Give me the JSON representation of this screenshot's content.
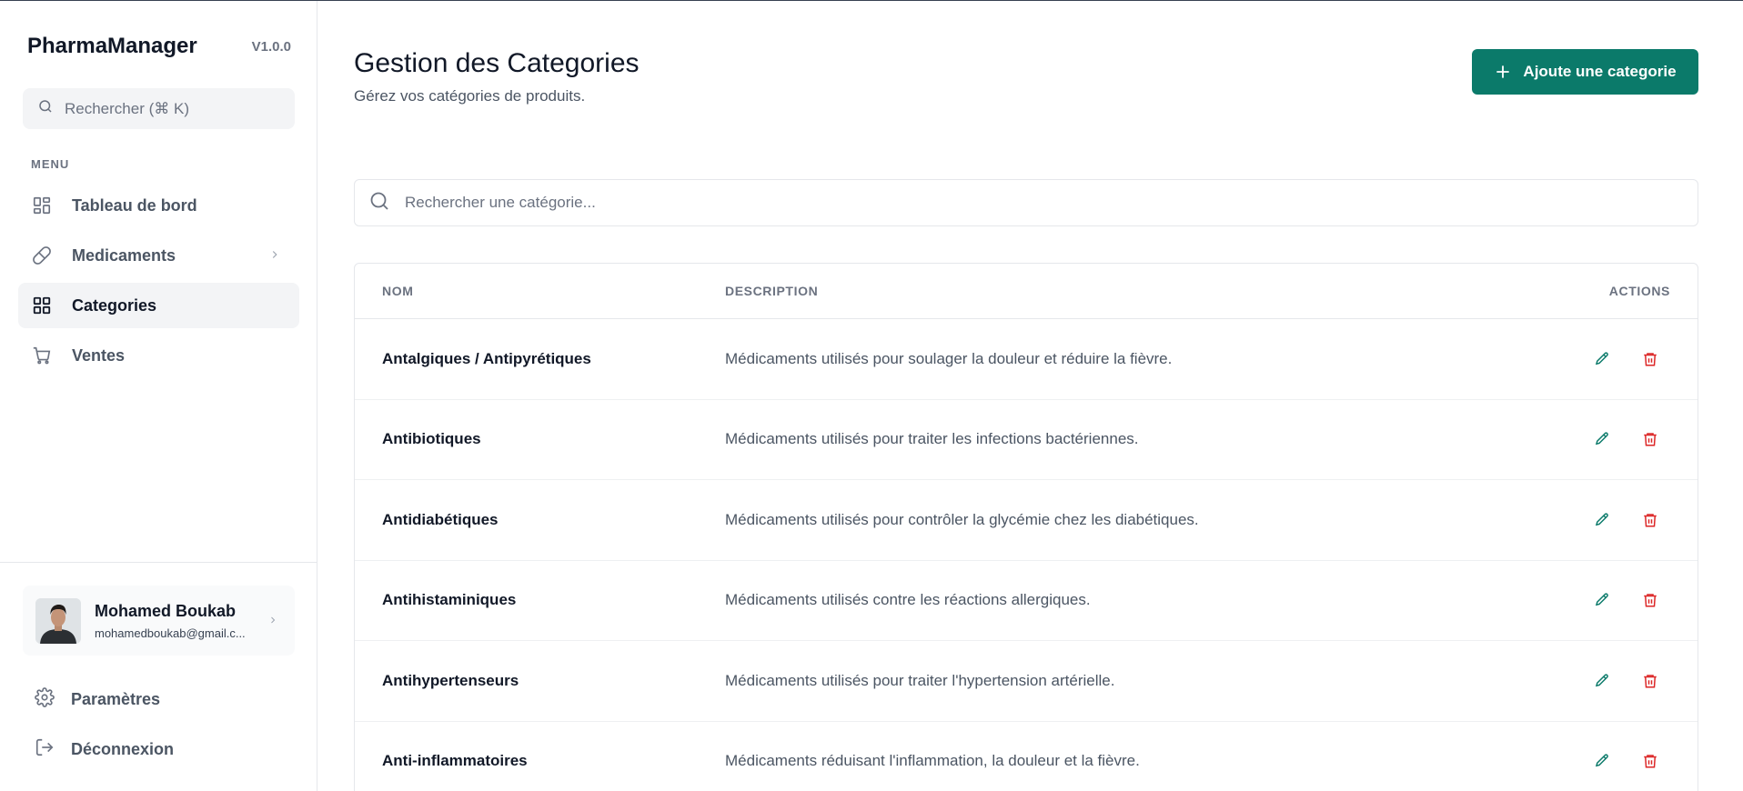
{
  "sidebar": {
    "brand": "PharmaManager",
    "version": "V1.0.0",
    "search_placeholder": "Rechercher (⌘ K)",
    "menu_label": "MENU",
    "items": [
      {
        "label": "Tableau de bord",
        "icon": "dashboard-icon"
      },
      {
        "label": "Medicaments",
        "icon": "pill-icon"
      },
      {
        "label": "Categories",
        "icon": "grid-icon"
      },
      {
        "label": "Ventes",
        "icon": "cart-icon"
      }
    ],
    "user": {
      "name": "Mohamed Boukab",
      "email": "mohamedboukab@gmail.c..."
    },
    "settings_label": "Paramètres",
    "logout_label": "Déconnexion"
  },
  "main": {
    "title": "Gestion des Categories",
    "subtitle": "Gérez vos catégories de produits.",
    "add_button": "Ajoute une categorie",
    "search_placeholder": "Rechercher une catégorie...",
    "table": {
      "headers": {
        "nom": "NOM",
        "description": "DESCRIPTION",
        "actions": "ACTIONS"
      },
      "rows": [
        {
          "nom": "Antalgiques / Antipyrétiques",
          "description": "Médicaments utilisés pour soulager la douleur et réduire la fièvre."
        },
        {
          "nom": "Antibiotiques",
          "description": "Médicaments utilisés pour traiter les infections bactériennes."
        },
        {
          "nom": "Antidiabétiques",
          "description": "Médicaments utilisés pour contrôler la glycémie chez les diabétiques."
        },
        {
          "nom": "Antihistaminiques",
          "description": "Médicaments utilisés contre les réactions allergiques."
        },
        {
          "nom": "Antihypertenseurs",
          "description": "Médicaments utilisés pour traiter l'hypertension artérielle."
        },
        {
          "nom": "Anti-inflammatoires",
          "description": "Médicaments réduisant l'inflammation, la douleur et la fièvre."
        }
      ]
    }
  },
  "colors": {
    "accent": "#0b7a6a",
    "edit": "#0b7a6a",
    "delete": "#dc2626",
    "active_bg": "#f3f4f6"
  }
}
